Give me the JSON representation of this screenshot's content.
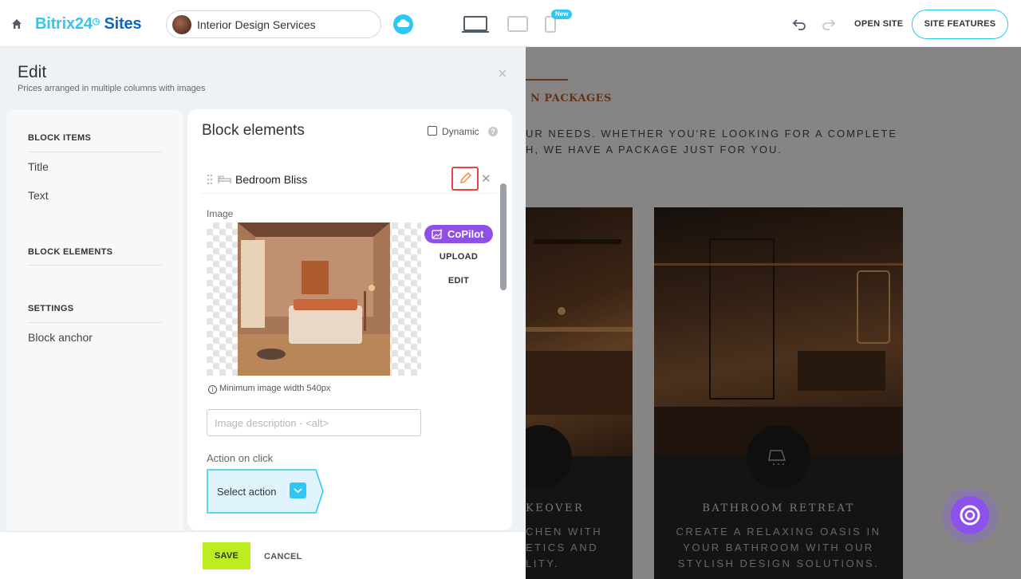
{
  "header": {
    "logo_brand": "Bitrix24",
    "logo_sites": "Sites",
    "site_name": "Interior Design Services",
    "new_badge": "New",
    "open_site": "OPEN SITE",
    "site_features": "SITE FEATURES"
  },
  "panel": {
    "title": "Edit",
    "subtitle": "Prices arranged in multiple columns with images",
    "nav": {
      "block_items_header": "BLOCK ITEMS",
      "items": [
        "Title",
        "Text"
      ],
      "block_elements_header": "BLOCK ELEMENTS",
      "settings_header": "SETTINGS",
      "settings_items": [
        "Block anchor"
      ]
    },
    "content": {
      "title": "Block elements",
      "dynamic_label": "Dynamic",
      "dynamic_checked": false,
      "help": "?",
      "item_title": "Bedroom Bliss",
      "image_label": "Image",
      "copilot_label": "CoPilot",
      "upload_label": "UPLOAD",
      "edit_label": "EDIT",
      "min_width_note": "Minimum image width 540px",
      "alt_placeholder": "Image description - <alt>",
      "alt_value": "",
      "action_label": "Action on click",
      "action_value": "Select action"
    },
    "footer": {
      "save": "SAVE",
      "cancel": "CANCEL"
    }
  },
  "preview": {
    "heading_fragment": "N PACKAGES",
    "paragraph_line1": "UR NEEDS. WHETHER YOU'RE LOOKING FOR A COMPLETE",
    "paragraph_line2": "H, WE HAVE A PACKAGE JUST FOR YOU.",
    "card1_title_fragment": "KEOVER",
    "card1_text_line1": "CHEN WITH",
    "card1_text_line2": "ETICS AND",
    "card1_text_line3": "LITY.",
    "card2_title": "BATHROOM RETREAT",
    "card2_text_line1": "CREATE A RELAXING OASIS IN",
    "card2_text_line2": "YOUR BATHROOM WITH OUR",
    "card2_text_line3": "STYLISH DESIGN SOLUTIONS."
  },
  "colors": {
    "accent": "#2fc6f6",
    "brand_dark": "#0b66c3",
    "save_button": "#bbed21",
    "copilot": "#9050e5",
    "highlight": "#e8453c"
  }
}
